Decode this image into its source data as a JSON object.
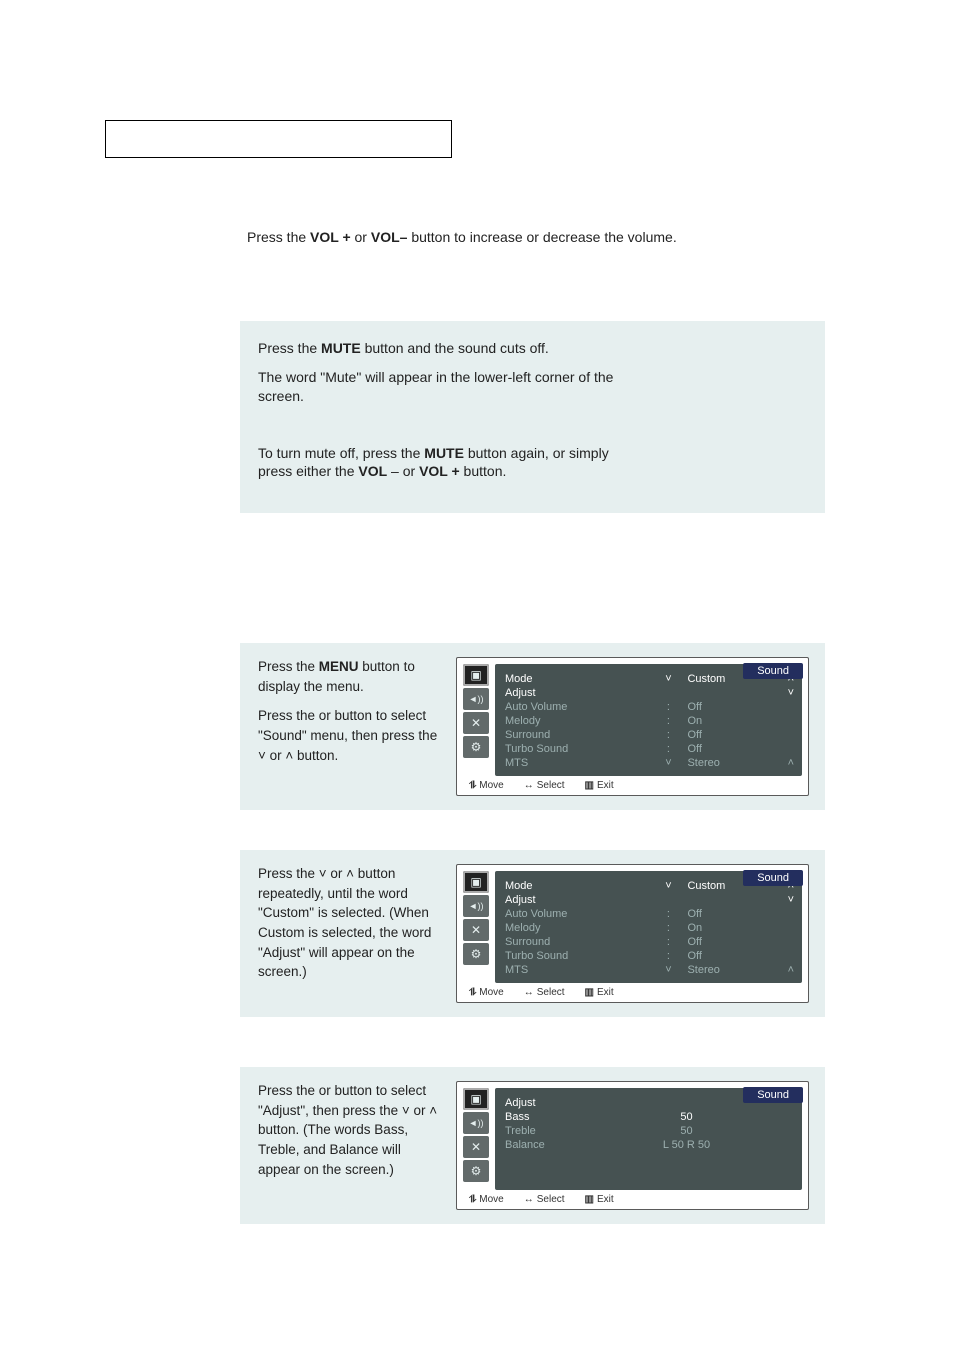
{
  "intro": {
    "volume_line_a": "Press the ",
    "volume_vol_plus": "VOL +",
    "volume_or": " or ",
    "volume_vol_minus": "VOL–",
    "volume_line_b": " button to increase or decrease the volume."
  },
  "mute": {
    "p1a": "Press the ",
    "p1b": "MUTE",
    "p1c": " button and the sound cuts off.",
    "p2": "The word \"Mute\" will appear in the lower-left corner of the screen.",
    "p3a": "To turn mute off, press the ",
    "p3b": "MUTE",
    "p3c": " button again, or simply press either the ",
    "p3d": "VOL",
    "p3e": " –  or ",
    "p3f": "VOL +",
    "p3g": " button."
  },
  "step1": {
    "t1a": "Press the ",
    "t1b": "MENU",
    "t1c": " button to display the menu.",
    "t2a": "Press the    or    button to select  \"Sound\" menu, then press the  ˅  or  ˄ button."
  },
  "step2": {
    "t": "Press the  ˅  or  ˄   button repeatedly, until the word \"Custom\" is selected.  (When Custom is selected, the word \"Adjust\" will appear on the screen.)"
  },
  "step3": {
    "t": "Press the    or    button to select \"Adjust\", then press the  ˅  or  ˄   button.  (The words Bass, Treble, and Balance will appear on the screen.)"
  },
  "osd_sound": {
    "title": "Sound",
    "rows": [
      {
        "k": "Mode",
        "sep": "˅",
        "v": "Custom",
        "suf": "˄",
        "hi": true
      },
      {
        "k": "Adjust",
        "sep": "",
        "v": "",
        "suf": "",
        "hi": true
      },
      {
        "k": "Auto Volume",
        "sep": ":",
        "v": "Off",
        "suf": "",
        "hi": false
      },
      {
        "k": "Melody",
        "sep": ":",
        "v": "On",
        "suf": "",
        "hi": false
      },
      {
        "k": "Surround",
        "sep": ":",
        "v": "Off",
        "suf": "",
        "hi": false
      },
      {
        "k": "Turbo Sound",
        "sep": ":",
        "v": "Off",
        "suf": "",
        "hi": false
      },
      {
        "k": "MTS",
        "sep": "˅",
        "v": "Stereo",
        "suf": "˄",
        "hi": false
      }
    ]
  },
  "osd_adjust": {
    "title": "Sound",
    "rows": [
      {
        "k": "Adjust",
        "v": "",
        "hi": true
      },
      {
        "k": "Bass",
        "v": "50",
        "hi": true
      },
      {
        "k": "Treble",
        "v": "50",
        "hi": false
      },
      {
        "k": "Balance",
        "v": "L  50    R  50",
        "hi": false
      }
    ]
  },
  "osd_nav": {
    "move": "Move",
    "select": "Select",
    "exit": "Exit"
  },
  "icons": {
    "tv": "▣",
    "speaker": "◄))",
    "tool": "✕",
    "sliders": "⚙"
  }
}
